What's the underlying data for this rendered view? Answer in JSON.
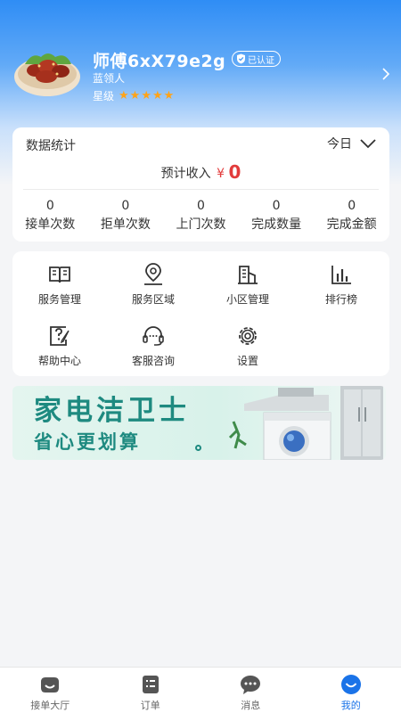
{
  "profile": {
    "name": "师傅6xX79e2g",
    "verified_badge": "已认证",
    "role": "蓝领人",
    "level_label": "星级",
    "stars": 5
  },
  "stats": {
    "title": "数据统计",
    "period": "今日",
    "income_label": "预计收入",
    "currency": "¥",
    "income_value": "0",
    "items": [
      {
        "value": "0",
        "label": "接单次数"
      },
      {
        "value": "0",
        "label": "拒单次数"
      },
      {
        "value": "0",
        "label": "上门次数"
      },
      {
        "value": "0",
        "label": "完成数量"
      },
      {
        "value": "0",
        "label": "完成金额"
      }
    ]
  },
  "tools": [
    {
      "label": "服务管理",
      "icon": "book-icon"
    },
    {
      "label": "服务区域",
      "icon": "location-icon"
    },
    {
      "label": "小区管理",
      "icon": "building-icon"
    },
    {
      "label": "排行榜",
      "icon": "bar-chart-icon"
    },
    {
      "label": "帮助中心",
      "icon": "help-icon"
    },
    {
      "label": "客服咨询",
      "icon": "headset-icon"
    },
    {
      "label": "设置",
      "icon": "gear-icon"
    }
  ],
  "banner": {
    "title": "家电洁卫士",
    "subtitle": "省心更划算"
  },
  "tabbar": {
    "items": [
      {
        "label": "接单大厅",
        "icon": "hall-icon",
        "active": false
      },
      {
        "label": "订单",
        "icon": "order-icon",
        "active": false
      },
      {
        "label": "消息",
        "icon": "message-icon",
        "active": false
      },
      {
        "label": "我的",
        "icon": "profile-icon",
        "active": true
      }
    ]
  },
  "colors": {
    "accent": "#1a73e8",
    "header_blue": "#2f8df5",
    "star": "#ffa318",
    "income_red": "#e23b3b",
    "banner_teal": "#1e8a80"
  }
}
